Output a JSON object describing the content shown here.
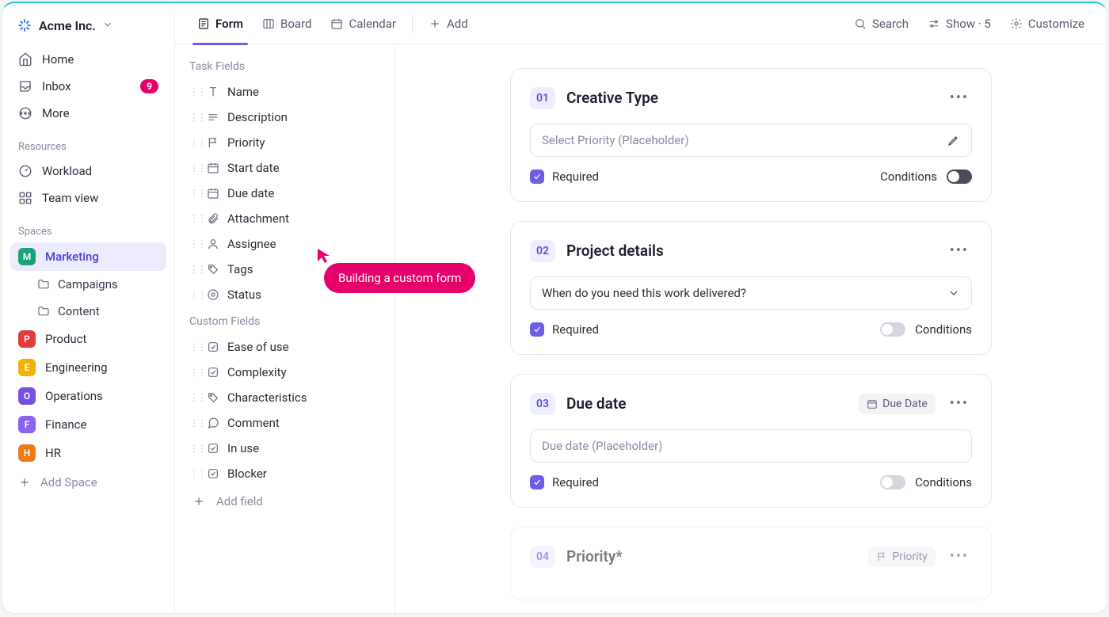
{
  "workspace": {
    "name": "Acme Inc."
  },
  "nav": {
    "home": "Home",
    "inbox": "Inbox",
    "inbox_count": "9",
    "more": "More"
  },
  "sections": {
    "resources": "Resources",
    "spaces": "Spaces"
  },
  "resources": {
    "workload": "Workload",
    "teamview": "Team view"
  },
  "spaces": [
    {
      "letter": "M",
      "label": "Marketing",
      "color": "#1aa37a",
      "active": true,
      "children": [
        {
          "label": "Campaigns"
        },
        {
          "label": "Content"
        }
      ]
    },
    {
      "letter": "P",
      "label": "Product",
      "color": "#e23b3b"
    },
    {
      "letter": "E",
      "label": "Engineering",
      "color": "#f2b202"
    },
    {
      "letter": "O",
      "label": "Operations",
      "color": "#7a4fe0"
    },
    {
      "letter": "F",
      "label": "Finance",
      "color": "#8a63f0"
    },
    {
      "letter": "H",
      "label": "HR",
      "color": "#f07a1a"
    }
  ],
  "add_space": "Add Space",
  "tabs": {
    "form": "Form",
    "board": "Board",
    "calendar": "Calendar",
    "add": "Add"
  },
  "toolbar": {
    "search": "Search",
    "show": "Show · 5",
    "customize": "Customize"
  },
  "fields_panel": {
    "task_fields": "Task Fields",
    "custom_fields": "Custom Fields",
    "add_field": "Add field",
    "task": [
      "Name",
      "Description",
      "Priority",
      "Start date",
      "Due date",
      "Attachment",
      "Assignee",
      "Tags",
      "Status"
    ],
    "custom": [
      "Ease of use",
      "Complexity",
      "Characteristics",
      "Comment",
      "In use",
      "Blocker"
    ]
  },
  "form_cards": [
    {
      "num": "01",
      "title": "Creative Type",
      "placeholder": "Select Priority (Placeholder)",
      "required": "Required",
      "conditions": "Conditions",
      "input_filled": false,
      "edit_icon": true,
      "toggle_dark": true,
      "cond_first": true
    },
    {
      "num": "02",
      "title": "Project details",
      "placeholder": "When do you need this work delivered?",
      "required": "Required",
      "conditions": "Conditions",
      "input_filled": true,
      "chevron": true,
      "toggle_dark": false,
      "cond_first": false
    },
    {
      "num": "03",
      "title": "Due date",
      "placeholder": "Due date (Placeholder)",
      "required": "Required",
      "conditions": "Conditions",
      "chip": "Due Date",
      "input_filled": false,
      "toggle_dark": false,
      "cond_first": false
    },
    {
      "num": "04",
      "title": "Priority*",
      "chip": "Priority",
      "muted": true
    }
  ],
  "tooltip": "Building a custom form"
}
